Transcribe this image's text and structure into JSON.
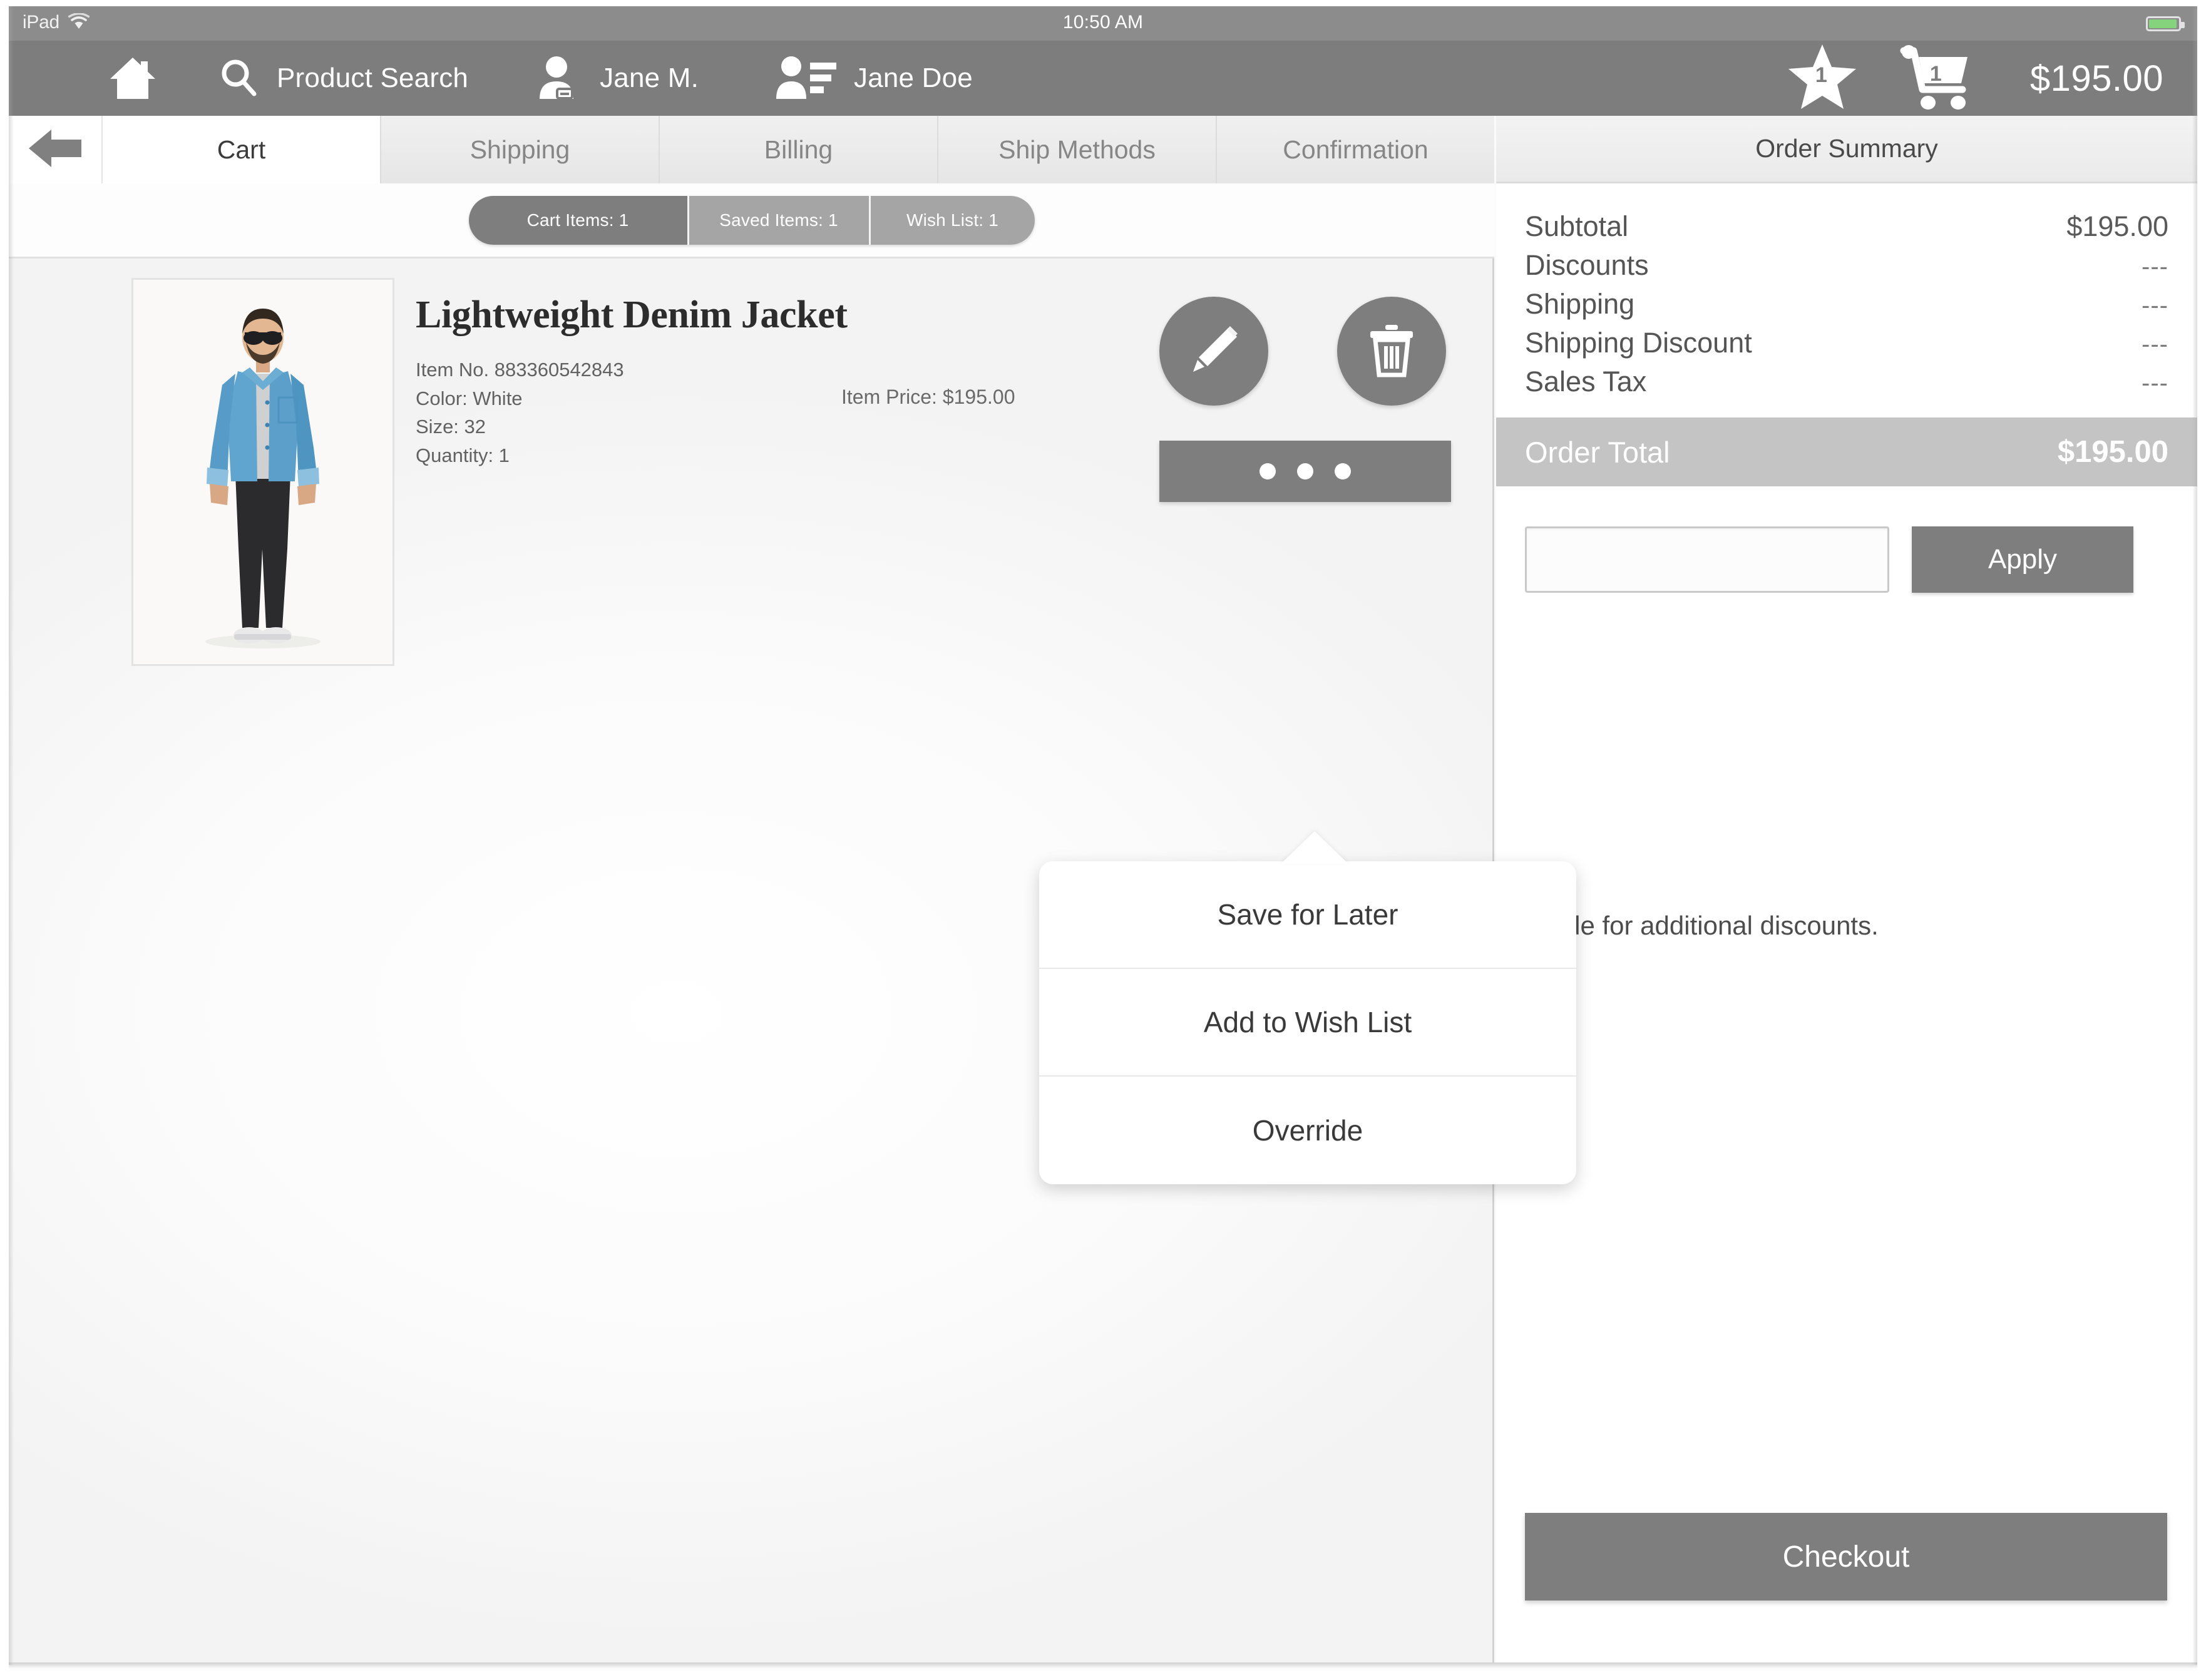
{
  "status_bar": {
    "device": "iPad",
    "wifi_icon": "wifi-icon",
    "time": "10:50 AM",
    "battery_icon": "battery-icon",
    "battery_color": "#86d37e"
  },
  "app_bar": {
    "menu_icon": "hamburger-menu-icon",
    "home_icon": "home-icon",
    "search_icon": "search-icon",
    "search_label": "Product Search",
    "associate_icon": "employee-badge-icon",
    "associate_name": "Jane M.",
    "customer_icon": "customer-contact-icon",
    "customer_name": "Jane Doe",
    "wishlist_icon": "star-icon",
    "wishlist_count": "1",
    "cart_icon": "shopping-cart-icon",
    "cart_count": "1",
    "cart_total": "$195.00",
    "bar_color": "#7d7d7d"
  },
  "checkout_tabs": {
    "back_icon": "back-arrow-icon",
    "items": [
      {
        "label": "Cart",
        "active": true
      },
      {
        "label": "Shipping",
        "active": false
      },
      {
        "label": "Billing",
        "active": false
      },
      {
        "label": "Ship Methods",
        "active": false
      },
      {
        "label": "Confirmation",
        "active": false
      }
    ]
  },
  "segmented_control": [
    {
      "label": "Cart Items: 1",
      "selected": true
    },
    {
      "label": "Saved Items: 1",
      "selected": false
    },
    {
      "label": "Wish List: 1",
      "selected": false
    }
  ],
  "cart_item": {
    "image_alt": "denim-jacket-model-photo",
    "title": "Lightweight Denim Jacket",
    "item_no": "Item No. 883360542843",
    "color": "Color: White",
    "size": "Size: 32",
    "quantity": "Quantity: 1",
    "price": "Item Price: $195.00",
    "edit_icon": "pencil-icon",
    "delete_icon": "trash-icon",
    "more_icon": "ellipsis-icon"
  },
  "popup_menu": {
    "items": [
      "Save for Later",
      "Add to Wish List",
      "Override"
    ]
  },
  "order_summary": {
    "header": "Order Summary",
    "rows": [
      {
        "label": "Subtotal",
        "value": "$195.00",
        "dash": false
      },
      {
        "label": "Discounts",
        "value": "---",
        "dash": true
      },
      {
        "label": "Shipping",
        "value": "---",
        "dash": true
      },
      {
        "label": "Shipping Discount",
        "value": "---",
        "dash": true
      },
      {
        "label": "Sales Tax",
        "value": "---",
        "dash": true
      }
    ],
    "total_label": "Order Total",
    "total_value": "$195.00",
    "total_bar_color": "#c4c4c4",
    "promo_value": "",
    "promo_placeholder": "",
    "apply_label": "Apply",
    "promo_hint": "Enter Promo Code for additional discounts.",
    "checkout_label": "Checkout"
  }
}
